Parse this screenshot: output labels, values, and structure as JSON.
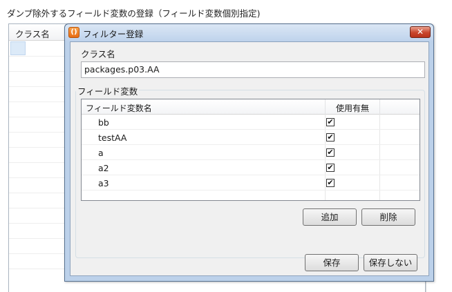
{
  "background": {
    "title": "ダンプ除外するフィールド変数の登録（フィールド変数個別指定)",
    "table_header": "クラス名"
  },
  "dialog": {
    "title": "フィルター登録",
    "class_label": "クラス名",
    "class_value": "packages.p03.AA",
    "group_label": "フィールド変数",
    "grid": {
      "columns": [
        "フィールド変数名",
        "使用有無"
      ],
      "rows": [
        {
          "name": "bb",
          "checked": true
        },
        {
          "name": "testAA",
          "checked": true
        },
        {
          "name": "a",
          "checked": true
        },
        {
          "name": "a2",
          "checked": true
        },
        {
          "name": "a3",
          "checked": true
        }
      ]
    },
    "buttons": {
      "add": "追加",
      "delete": "削除",
      "save": "保存",
      "no_save": "保存しない"
    }
  },
  "icons": {
    "app": "app-icon",
    "close": "close-icon",
    "checkmark": "✔"
  },
  "colors": {
    "title_bar": "#bfd3ec",
    "close_button": "#c9462c",
    "app_icon": "#e86b12"
  }
}
